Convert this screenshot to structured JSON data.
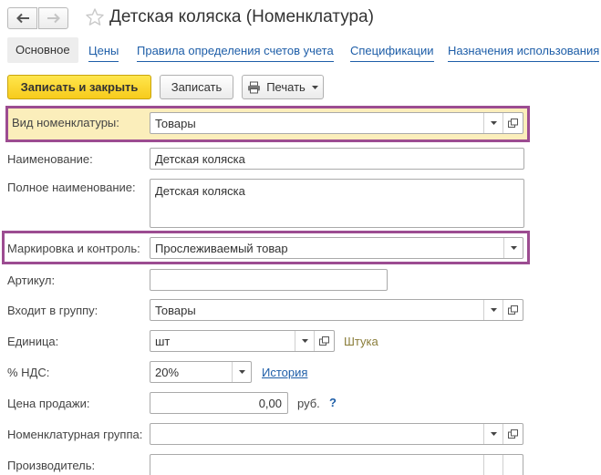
{
  "header": {
    "title": "Детская коляска (Номенклатура)",
    "icons": {
      "back": "arrow-left-icon",
      "forward": "arrow-right-icon",
      "favorite": "star-icon"
    }
  },
  "tabs": [
    {
      "label": "Основное",
      "active": true
    },
    {
      "label": "Цены"
    },
    {
      "label": "Правила определения счетов учета"
    },
    {
      "label": "Спецификации"
    },
    {
      "label": "Назначения использования"
    }
  ],
  "toolbar": {
    "save_close": "Записать и закрыть",
    "save": "Записать",
    "print": "Печать"
  },
  "form": {
    "kind": {
      "label": "Вид номенклатуры:",
      "value": "Товары"
    },
    "name": {
      "label": "Наименование:",
      "value": "Детская коляска"
    },
    "full_name": {
      "label": "Полное наименование:",
      "value": "Детская коляска"
    },
    "marking": {
      "label": "Маркировка и контроль:",
      "value": "Прослеживаемый товар"
    },
    "article": {
      "label": "Артикул:",
      "value": ""
    },
    "group": {
      "label": "Входит в группу:",
      "value": "Товары"
    },
    "unit": {
      "label": "Единица:",
      "value": "шт",
      "hint": "Штука"
    },
    "vat": {
      "label": "% НДС:",
      "value": "20%",
      "link": "История"
    },
    "price": {
      "label": "Цена продажи:",
      "value": "0,00",
      "currency": "руб.",
      "help": "?"
    },
    "nom_group": {
      "label": "Номенклатурная группа:",
      "value": ""
    },
    "producer": {
      "label": "Производитель:",
      "value": ""
    }
  },
  "colors": {
    "accent_yellow": "#f7cb1c",
    "highlight_border": "#9c4c91",
    "link": "#1e5ea8",
    "hint_olive": "#8a7d3a"
  }
}
